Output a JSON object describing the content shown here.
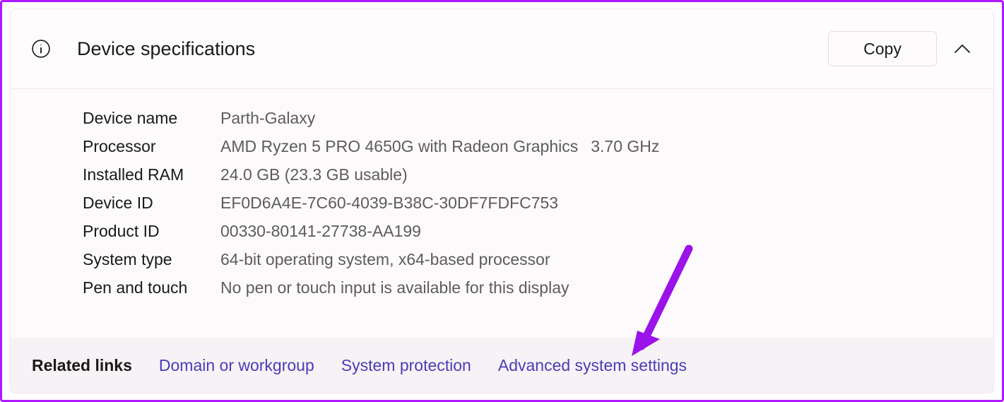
{
  "header": {
    "title": "Device specifications",
    "copy_label": "Copy"
  },
  "specs": [
    {
      "label": "Device name",
      "value": "Parth-Galaxy",
      "extra": ""
    },
    {
      "label": "Processor",
      "value": "AMD Ryzen 5 PRO 4650G with Radeon Graphics",
      "extra": "3.70 GHz"
    },
    {
      "label": "Installed RAM",
      "value": "24.0 GB (23.3 GB usable)",
      "extra": ""
    },
    {
      "label": "Device ID",
      "value": "EF0D6A4E-7C60-4039-B38C-30DF7FDFC753",
      "extra": ""
    },
    {
      "label": "Product ID",
      "value": "00330-80141-27738-AA199",
      "extra": ""
    },
    {
      "label": "System type",
      "value": "64-bit operating system, x64-based processor",
      "extra": ""
    },
    {
      "label": "Pen and touch",
      "value": "No pen or touch input is available for this display",
      "extra": ""
    }
  ],
  "footer": {
    "title": "Related links",
    "links": [
      "Domain or workgroup",
      "System protection",
      "Advanced system settings"
    ]
  }
}
